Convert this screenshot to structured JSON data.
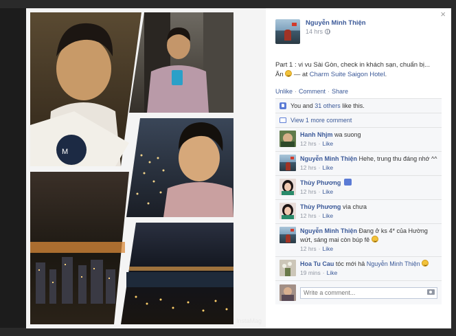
{
  "photo": {
    "watermark": "InstaMag"
  },
  "post": {
    "close_symbol": "×",
    "author": "Nguyễn Minh Thiện",
    "time": "14 hrs",
    "text": "Part 1 : vi vu Sài Gòn, check in khách sạn, chuẩn bị...",
    "text_line2": "Ăn",
    "location_prefix": " — at ",
    "location": "Charm Suite Saigon Hotel",
    "location_suffix": ".",
    "actions": {
      "unlike": "Unlike",
      "comment": "Comment",
      "share": "Share",
      "separator": "·"
    },
    "likes": {
      "prefix": "You and ",
      "others": "31 others",
      "suffix": " like this."
    },
    "view_more": "View 1 more comment"
  },
  "comments": [
    {
      "author": "Hanh Nhjm",
      "text": "wa suong",
      "time": "12 hrs",
      "like": "Like",
      "avatar": "green"
    },
    {
      "author": "Nguyễn Minh Thiện",
      "text": "Hehe, trung thu đáng nhớ ^^",
      "time": "12 hrs",
      "like": "Like",
      "avatar": "author"
    },
    {
      "author": "Thùy Phương",
      "text": "",
      "time": "12 hrs",
      "like": "Like",
      "avatar": "girl",
      "thumb": true
    },
    {
      "author": "Thùy Phương",
      "text": "vìa chưa",
      "time": "12 hrs",
      "like": "Like",
      "avatar": "girl"
    },
    {
      "author": "Nguyễn Minh Thiện",
      "text": "Đang ở ks 4* của Hường wứt, sáng mai còn búp fê",
      "time": "12 hrs",
      "like": "Like",
      "avatar": "author",
      "emoji": true
    },
    {
      "author": "Hoa Tu Cau",
      "text": "tóc mới hả ",
      "mention": "Nguyễn Minh Thiện",
      "time": "19 mins",
      "like": "Like",
      "avatar": "flowers",
      "emoji": true
    }
  ],
  "write_comment": {
    "placeholder": "Write a comment..."
  },
  "colors": {
    "link": "#3b5998",
    "meta": "#9197a3",
    "ufi_bg": "#f6f7f9"
  }
}
